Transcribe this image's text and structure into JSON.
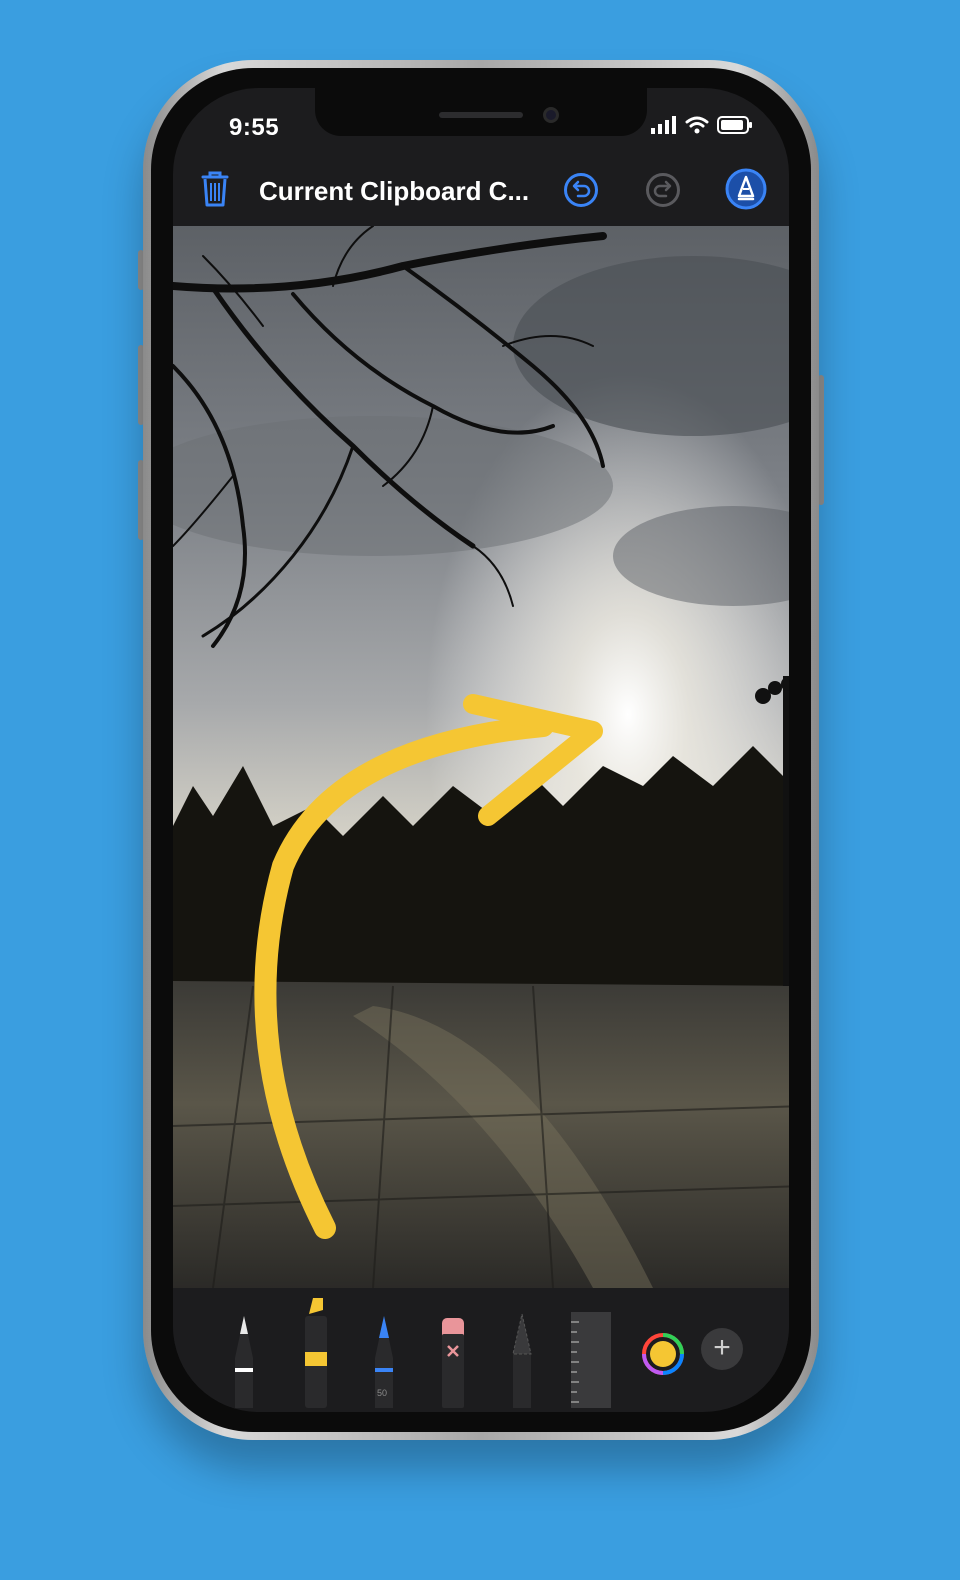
{
  "status_bar": {
    "time": "9:55"
  },
  "toolbar": {
    "title": "Current Clipboard C..."
  },
  "tools": {
    "pen_size_label": "50"
  },
  "colors": {
    "accent": "#3A84F6",
    "background": "#3A9EE0",
    "highlighter": "#F5C633"
  }
}
